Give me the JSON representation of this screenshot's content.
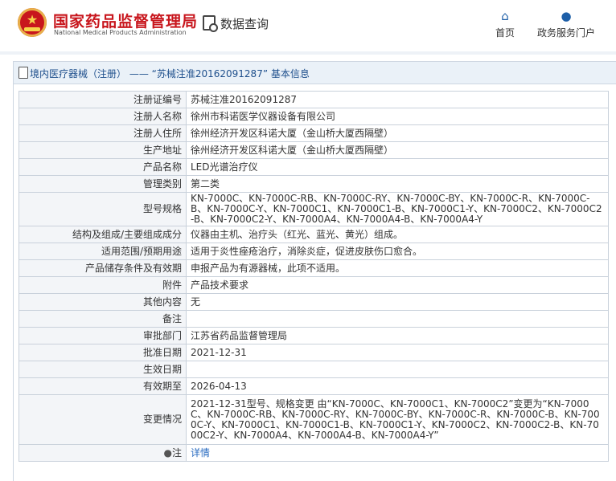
{
  "header": {
    "site_name": "国家药品监督管理局",
    "site_name_en": "National Medical Products Administration",
    "search_label": "数据查询",
    "nav": [
      {
        "label": "首页",
        "icon": "home-icon"
      },
      {
        "label": "政务服务门户",
        "icon": "user-icon"
      }
    ]
  },
  "panel": {
    "title": "境内医疗器械（注册） —— “苏械注准20162091287” 基本信息"
  },
  "rows": [
    {
      "label": "注册证编号",
      "value": "苏械注准20162091287"
    },
    {
      "label": "注册人名称",
      "value": "徐州市科诺医学仪器设备有限公司"
    },
    {
      "label": "注册人住所",
      "value": "徐州经济开发区科诺大厦（金山桥大厦西隔壁）"
    },
    {
      "label": "生产地址",
      "value": "徐州经济开发区科诺大厦（金山桥大厦西隔壁）"
    },
    {
      "label": "产品名称",
      "value": "LED光谱治疗仪"
    },
    {
      "label": "管理类别",
      "value": "第二类"
    },
    {
      "label": "型号规格",
      "value": "KN-7000C、KN-7000C-RB、KN-7000C-RY、KN-7000C-BY、KN-7000C-R、KN-7000C-B、KN-7000C-Y、KN-7000C1、KN-7000C1-B、KN-7000C1-Y、KN-7000C2、KN-7000C2-B、KN-7000C2-Y、KN-7000A4、KN-7000A4-B、KN-7000A4-Y"
    },
    {
      "label": "结构及组成/主要组成成分",
      "value": "仪器由主机、治疗头（红光、蓝光、黄光）组成。"
    },
    {
      "label": "适用范围/预期用途",
      "value": "适用于炎性痤疮治疗，消除炎症，促进皮肤伤口愈合。"
    },
    {
      "label": "产品储存条件及有效期",
      "value": "申报产品为有源器械，此项不适用。"
    },
    {
      "label": "附件",
      "value": "产品技术要求"
    },
    {
      "label": "其他内容",
      "value": "无"
    },
    {
      "label": "备注",
      "value": ""
    },
    {
      "label": "审批部门",
      "value": "江苏省药品监督管理局"
    },
    {
      "label": "批准日期",
      "value": "2021-12-31"
    },
    {
      "label": "生效日期",
      "value": ""
    },
    {
      "label": "有效期至",
      "value": "2026-04-13"
    },
    {
      "label": "变更情况",
      "value": "2021-12-31型号、规格变更 由“KN-7000C、KN-7000C1、KN-7000C2”变更为“KN-7000C、KN-7000C-RB、KN-7000C-RY、KN-7000C-BY、KN-7000C-R、KN-7000C-B、KN-7000C-Y、KN-7000C1、KN-7000C1-B、KN-7000C1-Y、KN-7000C2、KN-7000C2-B、KN-7000C2-Y、KN-7000A4、KN-7000A4-B、KN-7000A4-Y”"
    }
  ],
  "note_row": {
    "label": "注",
    "icon": "location-pin-icon",
    "link": "详情"
  },
  "colors": {
    "brand_red": "#c8161d",
    "link_blue": "#2a6cc1",
    "header_blue": "#1e4f8c"
  }
}
